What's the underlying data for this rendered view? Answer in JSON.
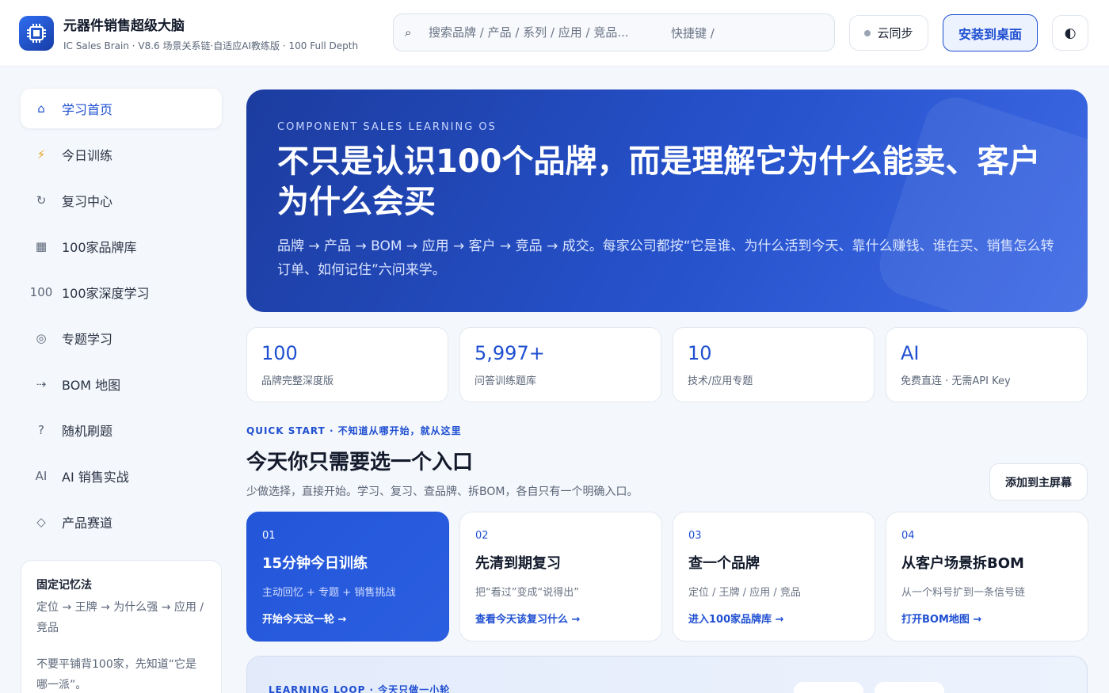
{
  "header": {
    "app_title": "元器件销售超级大脑",
    "app_subtitle": "IC Sales Brain · V8.6 场景关系链·自适应AI教练版 · 100 Full Depth",
    "search_placeholder": "搜索品牌 / 产品 / 系列 / 应用 / 竞品...",
    "search_hint": "快捷键 /",
    "sync_label": "云同步",
    "install_label": "安装到桌面",
    "theme_icon": "◐"
  },
  "sidebar": {
    "items": [
      {
        "icon": "⌂",
        "label": "学习首页",
        "active": true
      },
      {
        "icon": "⚡",
        "label": "今日训练"
      },
      {
        "icon": "↻",
        "label": "复习中心"
      },
      {
        "icon": "▦",
        "label": "100家品牌库"
      },
      {
        "icon": "100",
        "label": "100家深度学习"
      },
      {
        "icon": "◎",
        "label": "专题学习"
      },
      {
        "icon": "⇢",
        "label": "BOM 地图"
      },
      {
        "icon": "?",
        "label": "随机刷题"
      },
      {
        "icon": "AI",
        "label": "AI 销售实战"
      },
      {
        "icon": "◇",
        "label": "产品赛道"
      }
    ],
    "memory_card": {
      "title": "固定记忆法",
      "text": "定位 → 王牌 → 为什么强 → 应用 / 竞品",
      "text2": "不要平铺背100家，先知道“它是哪一派”。"
    }
  },
  "hero": {
    "kicker": "COMPONENT SALES LEARNING OS",
    "title": "不只是认识100个品牌，而是理解它为什么能卖、客户为什么会买",
    "description": "品牌 → 产品 → BOM → 应用 → 客户 → 竞品 → 成交。每家公司都按“它是谁、为什么活到今天、靠什么赚钱、谁在买、销售怎么转订单、如何记住”六问来学。"
  },
  "stats": [
    {
      "value": "100",
      "label": "品牌完整深度版"
    },
    {
      "value": "5,997+",
      "label": "问答训练题库"
    },
    {
      "value": "10",
      "label": "技术/应用专题"
    },
    {
      "value": "AI",
      "label": "免费直连 · 无需API Key"
    }
  ],
  "quick_start": {
    "kicker": "QUICK START · 不知道从哪开始，就从这里",
    "title": "今天你只需要选一个入口",
    "subtitle": "少做选择，直接开始。学习、复习、查品牌、拆BOM，各自只有一个明确入口。",
    "add_home_label": "添加到主屏幕",
    "cards": [
      {
        "num": "01",
        "title": "15分钟今日训练",
        "desc": "主动回忆 + 专题 + 销售挑战",
        "link": "开始今天这一轮 →"
      },
      {
        "num": "02",
        "title": "先清到期复习",
        "desc": "把“看过”变成“说得出”",
        "link": "查看今天该复习什么 →"
      },
      {
        "num": "03",
        "title": "查一个品牌",
        "desc": "定位 / 王牌 / 应用 / 竞品",
        "link": "进入100家品牌库 →"
      },
      {
        "num": "04",
        "title": "从客户场景拆BOM",
        "desc": "从一个料号扩到一条信号链",
        "link": "打开BOM地图 →"
      }
    ]
  },
  "learning_loop": {
    "kicker": "LEARNING LOOP · 今天只做一小轮"
  }
}
